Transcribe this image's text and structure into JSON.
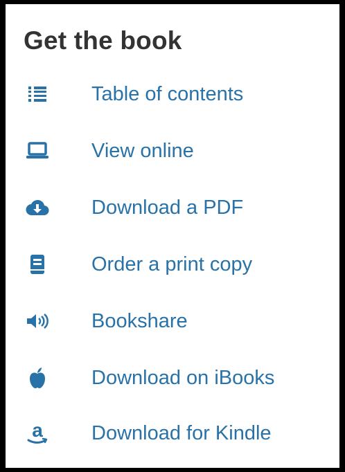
{
  "panel": {
    "title": "Get the book",
    "accent_color": "#2872a8",
    "title_color": "#333333",
    "links": [
      {
        "label": "Table of contents",
        "icon": "list-icon"
      },
      {
        "label": "View online",
        "icon": "laptop-icon"
      },
      {
        "label": "Download a PDF",
        "icon": "cloud-download-icon"
      },
      {
        "label": "Order a print copy",
        "icon": "book-icon"
      },
      {
        "label": "Bookshare",
        "icon": "volume-icon"
      },
      {
        "label": "Download on iBooks",
        "icon": "apple-icon"
      },
      {
        "label": "Download for Kindle",
        "icon": "amazon-icon"
      }
    ]
  }
}
